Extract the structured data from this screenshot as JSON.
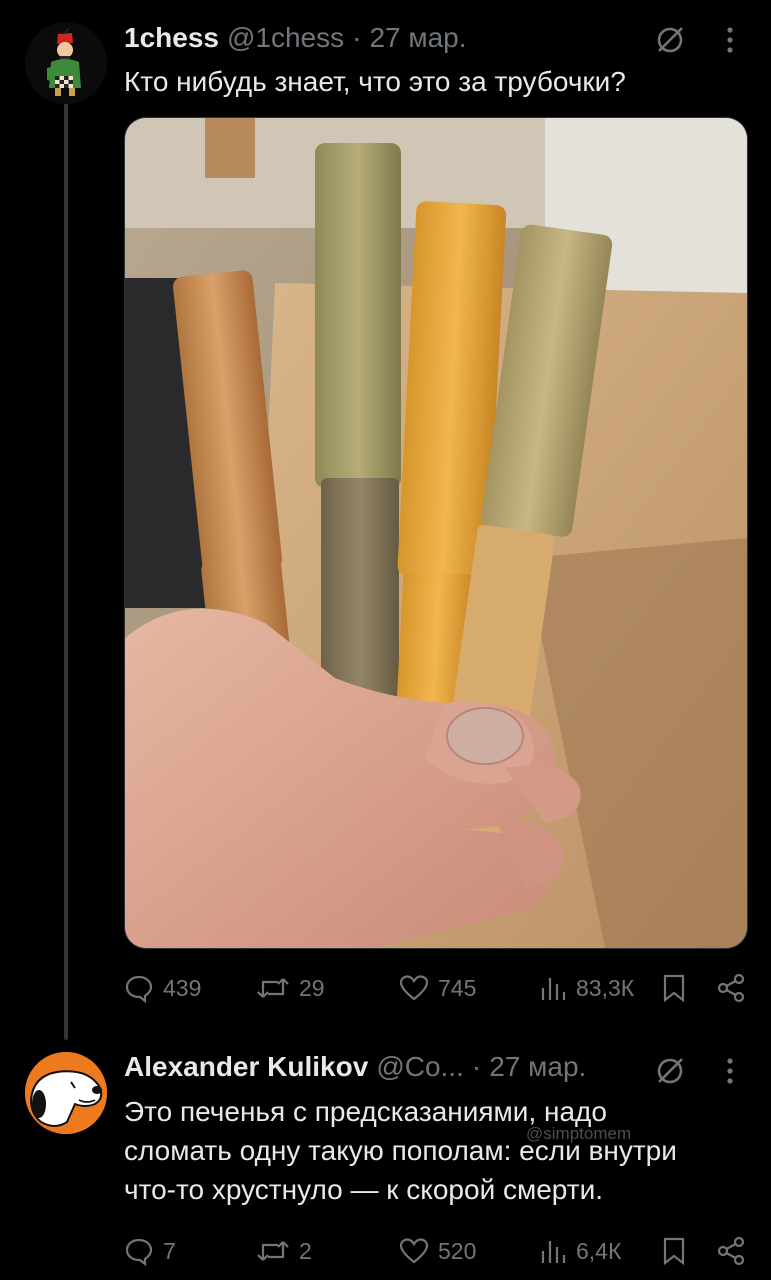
{
  "tweet1": {
    "name": "1chess",
    "handle": "@1chess",
    "dot": "·",
    "date": "27 мар.",
    "text": "Кто нибудь знает, что это за трубочки?",
    "stats": {
      "replies": "439",
      "reposts": "29",
      "likes": "745",
      "views": "83,3К"
    }
  },
  "tweet2": {
    "name": "Alexander Kulikov",
    "handle": "@Co...",
    "dot": "·",
    "date": "27 мар.",
    "text_lines": [
      "Это печенья с предсказаниями, надо",
      "сломать одну такую пополам: если внутри",
      "что-то хрустнуло — к скорой смерти."
    ],
    "stats": {
      "replies": "7",
      "reposts": "2",
      "likes": "520",
      "views": "6,4К"
    }
  },
  "watermark": "@simptomem",
  "icons": {
    "reply": "reply-icon",
    "repost": "repost-icon",
    "like": "heart-icon",
    "views": "views-chart-icon",
    "bookmark": "bookmark-icon",
    "share": "share-icon",
    "grok": "grok-icon",
    "more": "more-vertical-icon"
  },
  "colors": {
    "background": "#000000",
    "text": "#e7e9ea",
    "muted": "#71767b",
    "thread_line": "#333639"
  }
}
